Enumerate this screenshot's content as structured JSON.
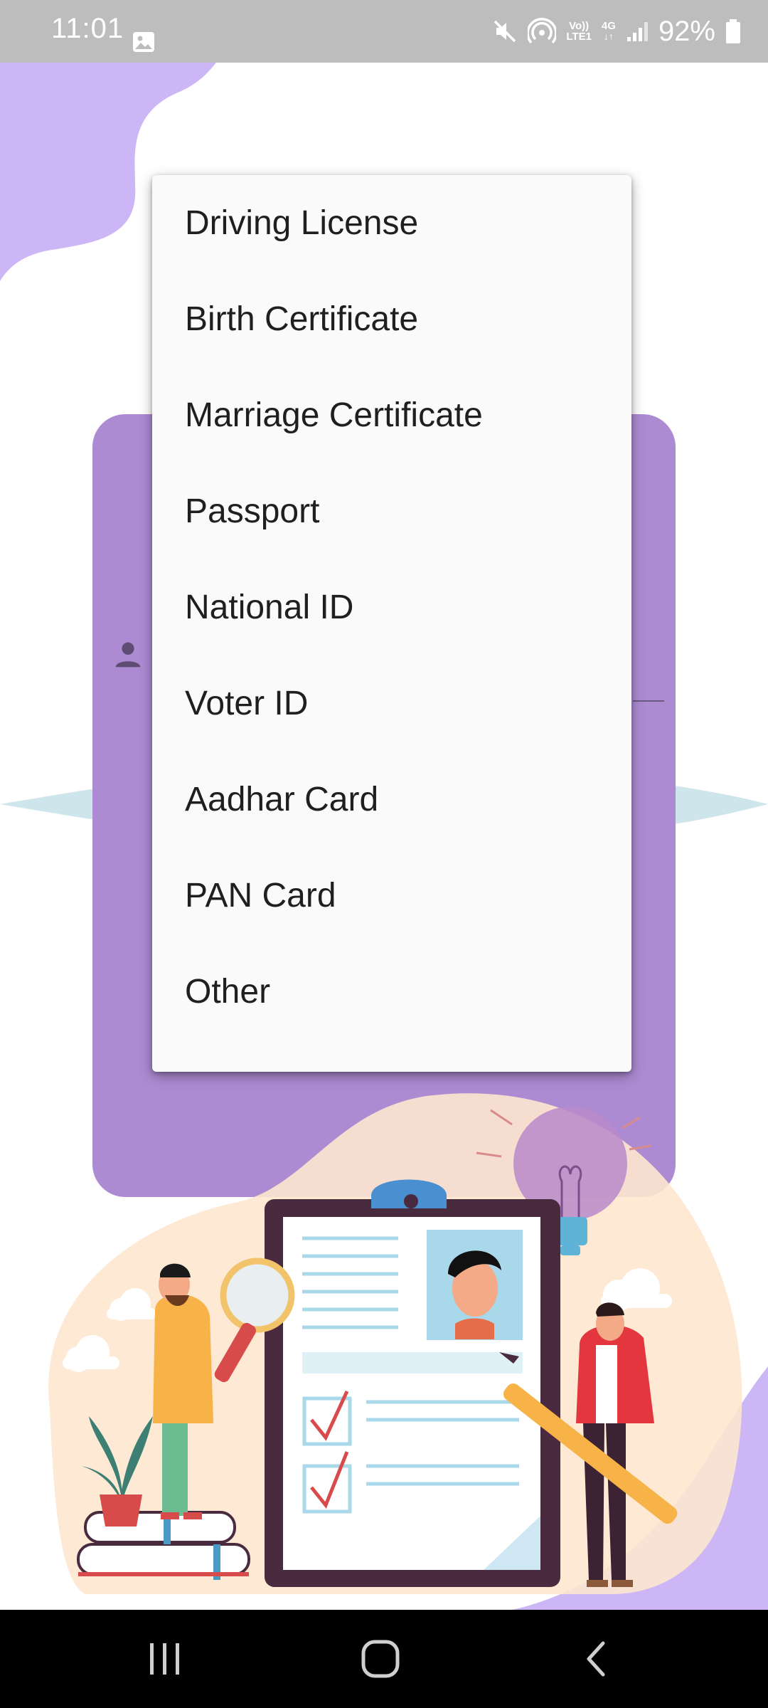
{
  "status_bar": {
    "time": "11:01",
    "battery": "92%",
    "volte_label_top": "Vo))",
    "volte_label_bottom": "LTE1",
    "network_label": "4G",
    "icons": [
      "gallery-icon",
      "mute-icon",
      "hotspot-icon",
      "volte-icon",
      "4g-icon",
      "signal-icon",
      "battery-icon"
    ]
  },
  "dropdown": {
    "items": [
      "Driving License",
      "Birth Certificate",
      "Marriage Certificate",
      "Passport",
      "National ID",
      "Voter ID",
      "Aadhar Card",
      "PAN Card",
      "Other"
    ]
  },
  "card": {
    "icons": [
      "person-icon"
    ]
  },
  "nav_bar": {
    "icons": [
      "recent-apps-icon",
      "home-icon",
      "back-icon"
    ]
  },
  "colors": {
    "status_bar": "#bdbdbd",
    "card": "#ad8bd3",
    "blob": "#cdb6f5",
    "menu_bg": "#fafafa",
    "nav_bar": "#000000"
  }
}
